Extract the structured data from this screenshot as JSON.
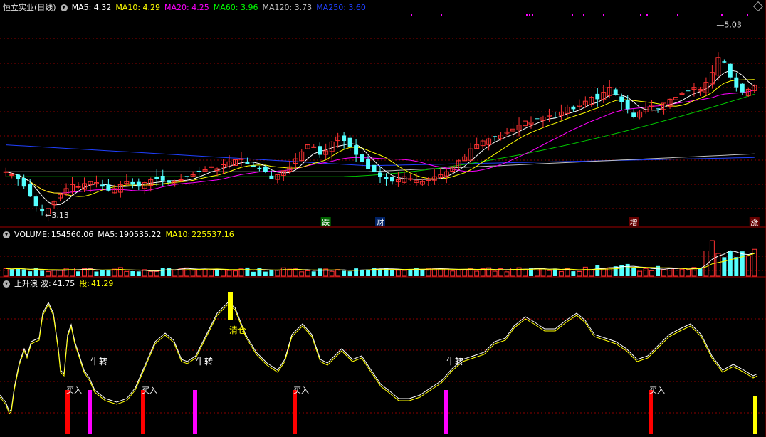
{
  "main": {
    "title": "恒立实业(日线)",
    "ma": [
      {
        "label": "MA5:",
        "value": "4.32",
        "color": "#ffffff"
      },
      {
        "label": "MA10:",
        "value": "4.29",
        "color": "#ffff00"
      },
      {
        "label": "MA20:",
        "value": "4.25",
        "color": "#ff00ff"
      },
      {
        "label": "MA60:",
        "value": "3.96",
        "color": "#00ff00"
      },
      {
        "label": "MA120:",
        "value": "3.73",
        "color": "#c0c0c0"
      },
      {
        "label": "MA250:",
        "value": "3.60",
        "color": "#2040ff"
      }
    ],
    "high_label": "5.03",
    "low_label": "3.13",
    "markers": [
      {
        "text": "跌",
        "bg": "#006600",
        "day": 53
      },
      {
        "text": "财",
        "bg": "#002266",
        "day": 62
      },
      {
        "text": "增",
        "bg": "#660000",
        "day": 104
      },
      {
        "text": "涨",
        "bg": "#660000",
        "day": 124
      }
    ]
  },
  "volume": {
    "label": "VOLUME:",
    "value": "154560.06",
    "ma5_label": "MA5:",
    "ma5_value": "190535.22",
    "ma10_label": "MA10:",
    "ma10_value": "225537.16"
  },
  "indicator": {
    "name": "上升浪",
    "wave_label": "波:",
    "wave_value": "41.75",
    "seg_label": "段:",
    "seg_value": "41.29",
    "annotations": [
      {
        "text": "牛转",
        "day": 16
      },
      {
        "text": "牛转",
        "day": 33
      },
      {
        "text": "牛转",
        "day": 75
      },
      {
        "text": "清仓",
        "day": 38
      }
    ],
    "buy_label": "买入"
  },
  "chart_data": {
    "type": "candlestick",
    "title": "恒立实业(日线)",
    "price_range": [
      3.0,
      5.15
    ],
    "high": 5.03,
    "low": 3.13,
    "bars": 125,
    "close": [
      3.55,
      3.52,
      3.48,
      3.4,
      3.3,
      3.2,
      3.15,
      3.18,
      3.25,
      3.32,
      3.38,
      3.42,
      3.4,
      3.43,
      3.45,
      3.44,
      3.4,
      3.36,
      3.38,
      3.42,
      3.45,
      3.42,
      3.4,
      3.44,
      3.47,
      3.48,
      3.46,
      3.44,
      3.45,
      3.47,
      3.5,
      3.52,
      3.55,
      3.57,
      3.6,
      3.58,
      3.62,
      3.65,
      3.67,
      3.68,
      3.63,
      3.6,
      3.58,
      3.55,
      3.48,
      3.52,
      3.56,
      3.6,
      3.68,
      3.75,
      3.82,
      3.8,
      3.72,
      3.76,
      3.85,
      3.9,
      3.86,
      3.8,
      3.72,
      3.65,
      3.58,
      3.55,
      3.5,
      3.48,
      3.45,
      3.47,
      3.5,
      3.48,
      3.46,
      3.45,
      3.48,
      3.5,
      3.52,
      3.55,
      3.6,
      3.66,
      3.7,
      3.78,
      3.82,
      3.86,
      3.88,
      3.9,
      3.92,
      3.95,
      3.98,
      4.02,
      4.06,
      4.05,
      4.08,
      4.1,
      4.12,
      4.1,
      4.15,
      4.2,
      4.18,
      4.22,
      4.26,
      4.3,
      4.28,
      4.35,
      4.4,
      4.32,
      4.25,
      4.18,
      4.1,
      4.15,
      4.2,
      4.22,
      4.18,
      4.24,
      4.28,
      4.3,
      4.34,
      4.36,
      4.4,
      4.38,
      4.45,
      4.55,
      4.7,
      4.65,
      4.5,
      4.4,
      4.35,
      4.38,
      4.42
    ],
    "volume_ma5": 190535.22,
    "volume_ma10": 225537.16,
    "indicator": {
      "wave": 41.75,
      "segment": 41.29
    }
  },
  "colors": {
    "up": "#ff3232",
    "down": "#54ffff",
    "grid": "#8b0000",
    "divider": "#a00000",
    "ma5": "#ffffff",
    "ma10": "#ffff00",
    "ma20": "#ff00ff",
    "ma60": "#00c800",
    "ma120": "#c0c0c0",
    "ma250": "#2040ff",
    "wave": "#ffffff",
    "segment": "#ffff00",
    "buy": "#ff0000",
    "bull": "#ff00ff",
    "clear": "#ffff00"
  }
}
